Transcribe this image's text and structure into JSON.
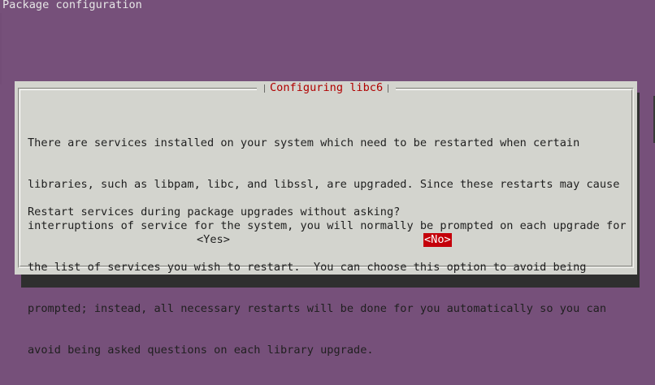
{
  "screen_title": "Package configuration",
  "dialog": {
    "title": "Configuring libc6",
    "message_lines": [
      "There are services installed on your system which need to be restarted when certain",
      "libraries, such as libpam, libc, and libssl, are upgraded. Since these restarts may cause",
      "interruptions of service for the system, you will normally be prompted on each upgrade for",
      "the list of services you wish to restart.  You can choose this option to avoid being",
      "prompted; instead, all necessary restarts will be done for you automatically so you can",
      "avoid being asked questions on each library upgrade."
    ],
    "question": "Restart services during package upgrades without asking?",
    "buttons": {
      "yes": "<Yes>",
      "no": "<No>"
    },
    "selected_button": "no"
  },
  "colors": {
    "background": "#76507a",
    "dialog_bg": "#d3d4ce",
    "title_text": "#b00000",
    "selected_button_bg": "#c4000a",
    "selected_button_text": "#ffffff",
    "shadow": "#2f2f2f"
  }
}
